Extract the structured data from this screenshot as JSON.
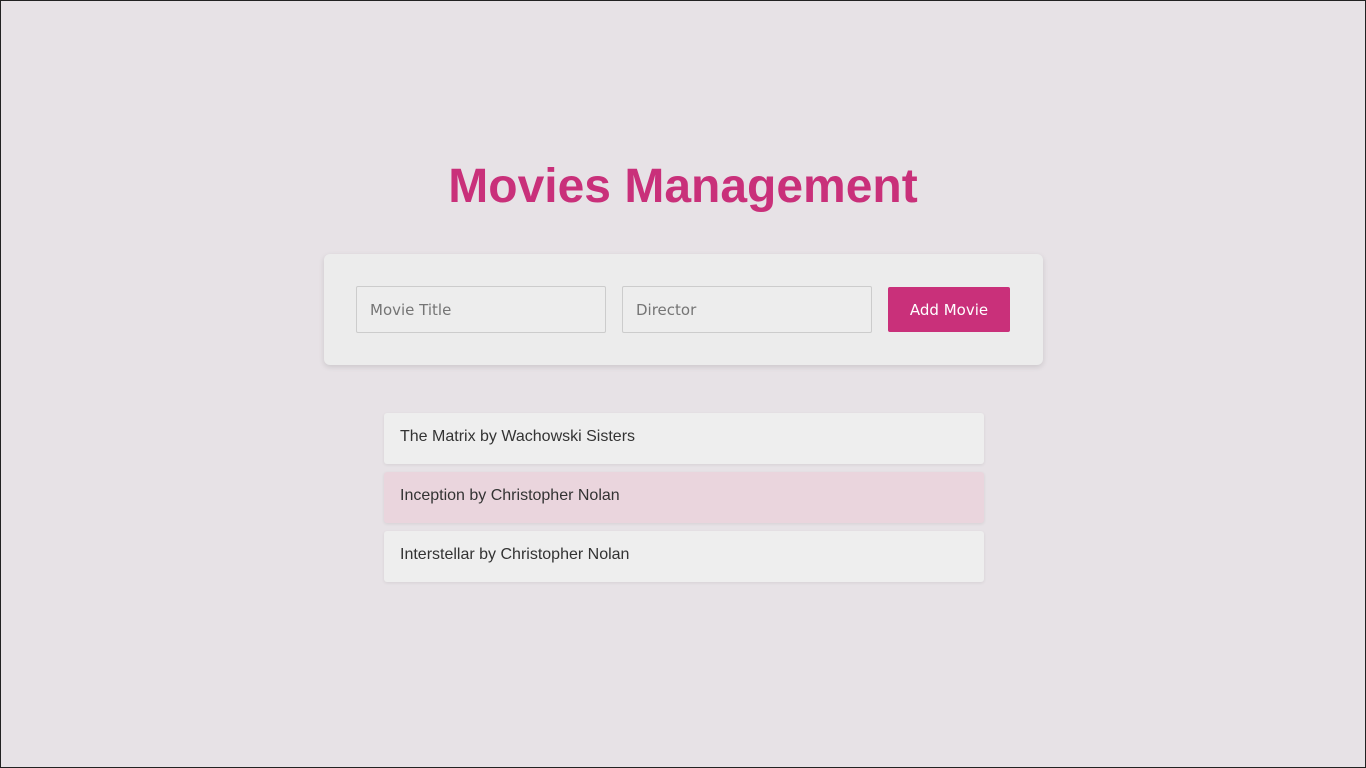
{
  "header": {
    "title": "Movies Management"
  },
  "form": {
    "title_placeholder": "Movie Title",
    "title_value": "",
    "director_placeholder": "Director",
    "director_value": "",
    "submit_label": "Add Movie"
  },
  "movies": [
    {
      "label": "The Matrix by Wachowski Sisters",
      "highlighted": false
    },
    {
      "label": "Inception by Christopher Nolan",
      "highlighted": true
    },
    {
      "label": "Interstellar by Christopher Nolan",
      "highlighted": false
    }
  ],
  "colors": {
    "accent": "#c9307a",
    "background": "#e7e2e6",
    "card": "#ececec",
    "item": "#eeeeee",
    "item_highlight": "#ead5dd"
  }
}
